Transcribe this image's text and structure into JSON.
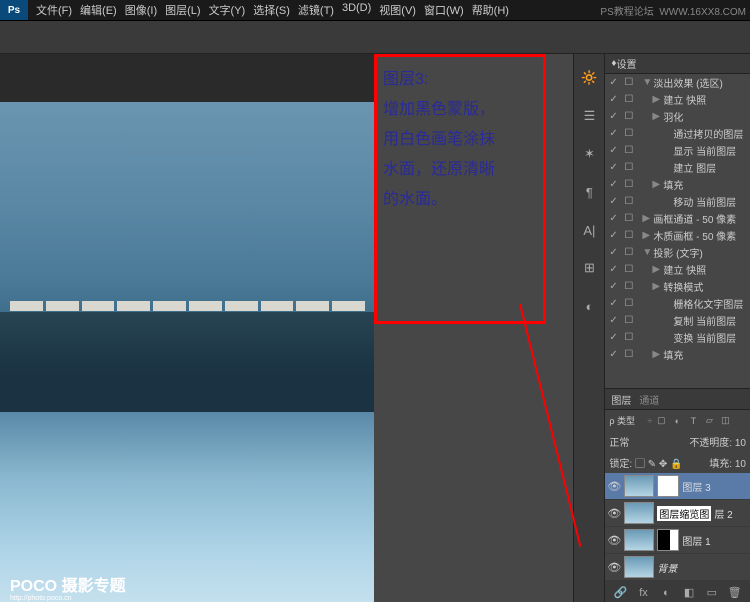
{
  "watermark": {
    "a": "PS教程论坛",
    "b": "WWW.16XX8.COM"
  },
  "logo": "Ps",
  "menu": [
    "文件(F)",
    "编辑(E)",
    "图像(I)",
    "图层(L)",
    "文字(Y)",
    "选择(S)",
    "滤镜(T)",
    "3D(D)",
    "视图(V)",
    "窗口(W)",
    "帮助(H)"
  ],
  "note": {
    "title": "图层3:",
    "l1": "增加黑色蒙版，",
    "l2": "用白色画笔涂抹",
    "l3": "水面，还原清晰",
    "l4": "的水面。"
  },
  "poco": {
    "big": "POCO 摄影专题",
    "small": "http://photo.poco.cn"
  },
  "vtab": [
    "🔆",
    "☰",
    "✶",
    "¶",
    "A|",
    "⊞",
    "◐"
  ],
  "actions_hdr": "设置",
  "actions": [
    {
      "i": 0,
      "a": "▼",
      "t": "淡出效果 (选区)"
    },
    {
      "i": 1,
      "a": "▶",
      "t": "建立 快照"
    },
    {
      "i": 1,
      "a": "▶",
      "t": "羽化"
    },
    {
      "i": 2,
      "a": "",
      "t": "通过拷贝的图层"
    },
    {
      "i": 2,
      "a": "",
      "t": "显示 当前图层"
    },
    {
      "i": 2,
      "a": "",
      "t": "建立 图层"
    },
    {
      "i": 1,
      "a": "▶",
      "t": "填充"
    },
    {
      "i": 2,
      "a": "",
      "t": "移动 当前图层"
    },
    {
      "i": 0,
      "a": "▶",
      "t": "画框通道 - 50 像素"
    },
    {
      "i": 0,
      "a": "▶",
      "t": "木质画框 - 50 像素"
    },
    {
      "i": 0,
      "a": "▼",
      "t": "投影 (文字)"
    },
    {
      "i": 1,
      "a": "▶",
      "t": "建立 快照"
    },
    {
      "i": 1,
      "a": "▶",
      "t": "转换模式"
    },
    {
      "i": 2,
      "a": "",
      "t": "栅格化文字图层"
    },
    {
      "i": 2,
      "a": "",
      "t": "复制 当前图层"
    },
    {
      "i": 2,
      "a": "",
      "t": "变换 当前图层"
    },
    {
      "i": 1,
      "a": "▶",
      "t": "填充"
    }
  ],
  "layers_panel": {
    "tab1": "图层",
    "tab2": "通道",
    "filter": "ρ 类型",
    "blend": "正常",
    "opacity_l": "不透明度:",
    "opacity_v": "10",
    "lock_l": "锁定:",
    "fill_l": "填充:",
    "fill_v": "10"
  },
  "layers": [
    {
      "name": "图层 3",
      "sel": true,
      "mask": "w"
    },
    {
      "name": "图层缩览图",
      "suffix": "层 2",
      "hl": true
    },
    {
      "name": "图层 1",
      "mask": "half"
    },
    {
      "name": "背景"
    }
  ],
  "lbot": [
    "🔗",
    "fx",
    "◐",
    "◧",
    "▭",
    "🗑"
  ]
}
